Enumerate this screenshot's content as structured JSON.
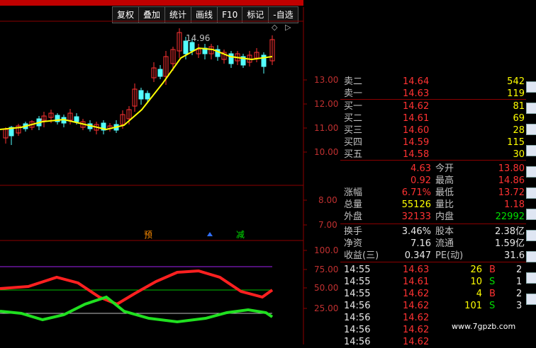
{
  "toolbar": {
    "buttons": [
      "复权",
      "叠加",
      "统计",
      "画线",
      "F10",
      "标记",
      "-自选"
    ]
  },
  "chart": {
    "price_ticks": [
      "13.00",
      "12.00",
      "11.00",
      "10.00"
    ],
    "vol_ticks": [
      "8.00",
      "7.00"
    ],
    "osc_ticks": [
      "100.0",
      "75.00",
      "50.00",
      "25.00"
    ],
    "high_label": "14.96",
    "markers": [
      "预",
      "减"
    ]
  },
  "orderbook": {
    "sell": [
      {
        "label": "卖二",
        "price": "14.64",
        "vol": "542"
      },
      {
        "label": "卖一",
        "price": "14.63",
        "vol": "119"
      }
    ],
    "buy": [
      {
        "label": "买一",
        "price": "14.62",
        "vol": "81"
      },
      {
        "label": "买二",
        "price": "14.61",
        "vol": "69"
      },
      {
        "label": "买三",
        "price": "14.60",
        "vol": "28"
      },
      {
        "label": "买四",
        "price": "14.59",
        "vol": "115"
      },
      {
        "label": "买五",
        "price": "14.58",
        "vol": "30"
      }
    ]
  },
  "quote": {
    "change_val": "4.63",
    "open_label": "今开",
    "open_val": "13.80",
    "change_abs": "0.92",
    "high_label": "最高",
    "high_val": "14.86",
    "pct_label": "涨幅",
    "pct_val": "6.71%",
    "low_label": "最低",
    "low_val": "13.72",
    "total_label": "总量",
    "total_val": "55126",
    "ratio_label": "量比",
    "ratio_val": "1.18",
    "outer_label": "外盘",
    "outer_val": "32133",
    "inner_label": "内盘",
    "inner_val": "22992",
    "turnover_label": "换手",
    "turnover_val": "3.46%",
    "share_label": "股本",
    "share_val": "2.38亿",
    "nav_label": "净资",
    "nav_val": "7.16",
    "float_label": "流通",
    "float_val": "1.59亿",
    "eps_label": "收益(三)",
    "eps_val": "0.347",
    "pe_label": "PE(动)",
    "pe_val": "31.6"
  },
  "ticks": [
    {
      "time": "14:55",
      "price": "14.63",
      "vol": "26",
      "side": "B",
      "n": "2"
    },
    {
      "time": "14:55",
      "price": "14.61",
      "vol": "10",
      "side": "S",
      "n": "1"
    },
    {
      "time": "14:55",
      "price": "14.62",
      "vol": "4",
      "side": "B",
      "n": "2"
    },
    {
      "time": "14:56",
      "price": "14.62",
      "vol": "101",
      "side": "S",
      "n": "3"
    },
    {
      "time": "14:56",
      "price": "14.62",
      "vol": "",
      "side": "",
      "n": ""
    },
    {
      "time": "14:56",
      "price": "14.62",
      "vol": "",
      "side": "",
      "n": ""
    },
    {
      "time": "14:56",
      "price": "14.62",
      "vol": "",
      "side": "",
      "n": ""
    }
  ],
  "watermark": "www.7gpzb.com"
}
